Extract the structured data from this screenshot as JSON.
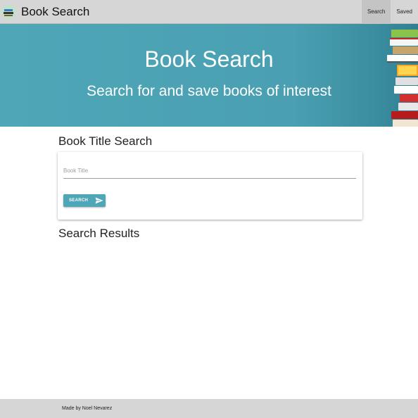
{
  "navbar": {
    "brand_title": "Book Search",
    "links": [
      {
        "label": "Search",
        "active": true
      },
      {
        "label": "Saved",
        "active": false
      }
    ]
  },
  "hero": {
    "title": "Book Search",
    "subtitle": "Search for and save books of interest"
  },
  "search_section": {
    "title": "Book Title Search",
    "input_placeholder": "Book Title",
    "input_value": "",
    "button_label": "SEARCH"
  },
  "results_section": {
    "title": "Search Results"
  },
  "footer": {
    "text": "Made by Noel Nevarez"
  },
  "colors": {
    "accent": "#4ea6b7",
    "nav_background": "#d6d6d6"
  }
}
